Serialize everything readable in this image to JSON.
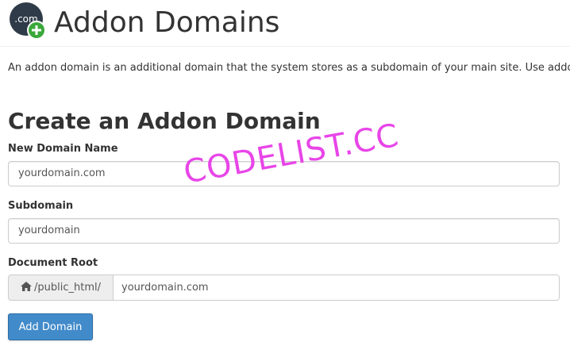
{
  "header": {
    "title": "Addon Domains",
    "logo_text": ".com",
    "logo_icon": "addon-domains-logo-icon"
  },
  "description": "An addon domain is an additional domain that the system stores as a subdomain of your main site. Use addo",
  "form": {
    "section_title": "Create an Addon Domain",
    "new_domain_label": "New Domain Name",
    "new_domain_value": "yourdomain.com",
    "subdomain_label": "Subdomain",
    "subdomain_value": "yourdomain",
    "document_root_label": "Document Root",
    "document_root_prefix": "/public_html/",
    "document_root_icon": "home-icon",
    "document_root_value": "yourdomain.com",
    "submit_label": "Add Domain"
  },
  "watermark": "CODELIST.CC",
  "colors": {
    "primary_button": "#428bca",
    "watermark": "#e845e8",
    "logo_green": "#3aa83a",
    "logo_dark": "#2f3b48"
  }
}
